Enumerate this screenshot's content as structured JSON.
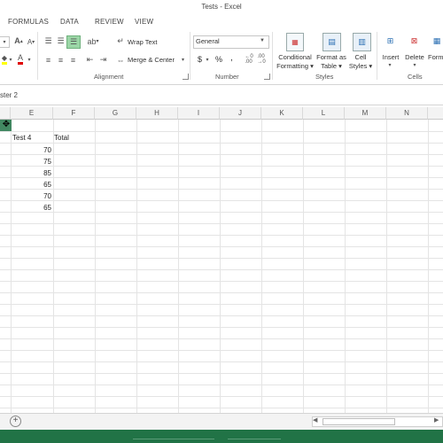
{
  "window": {
    "title": "Tests - Excel"
  },
  "ribbon_tabs": [
    "FORMULAS",
    "DATA",
    "REVIEW",
    "VIEW"
  ],
  "ribbon": {
    "wrap_text": "Wrap Text",
    "merge_center": "Merge & Center",
    "number_format": "General",
    "currency_symbol": "$",
    "percent_symbol": "%",
    "comma_symbol": ",",
    "conditional_formatting": [
      "Conditional",
      "Formatting ▾"
    ],
    "format_as_table": [
      "Format as",
      "Table ▾"
    ],
    "cell_styles": [
      "Cell",
      "Styles ▾"
    ],
    "insert": "Insert",
    "delete": "Delete",
    "format": "Form",
    "groups": {
      "alignment": "Alignment",
      "number": "Number",
      "styles": "Styles",
      "cells": "Cells"
    }
  },
  "formula_bar": {
    "text": "ster 2"
  },
  "columns": [
    "E",
    "F",
    "G",
    "H",
    "I",
    "J",
    "K",
    "L",
    "M",
    "N"
  ],
  "sheet": {
    "headers": {
      "test4": "Test 4",
      "total": "Total"
    },
    "test4_values": [
      "70",
      "75",
      "85",
      "65",
      "70",
      "65"
    ]
  },
  "sheet_bar": {
    "add_symbol": "+"
  },
  "colors": {
    "status_bar": "#217346",
    "selected_cell": "#217346"
  }
}
